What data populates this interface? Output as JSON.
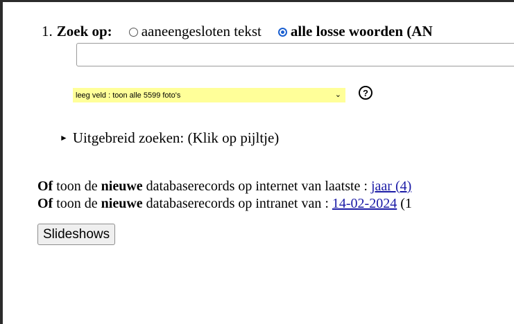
{
  "search": {
    "step_number": "1.",
    "label": "Zoek op:",
    "options": [
      {
        "label": "aaneengesloten tekst",
        "checked": false
      },
      {
        "label": "alle losse woorden (AN",
        "checked": true
      }
    ],
    "input_value": ""
  },
  "filter": {
    "selected": "leeg veld : toon alle 5599 foto's",
    "background_color": "#ffff99",
    "help_icon": "question-circle-icon",
    "help_text": "?"
  },
  "advanced": {
    "arrow_icon": "triangle-right-icon",
    "arrow_glyph": "►",
    "label": "Uitgebreid zoeken: (Klik op pijltje)"
  },
  "records": {
    "line1": {
      "of": "Of",
      "t1": " toon de ",
      "bold": "nieuwe",
      "t2": " databaserecords op internet van laatste : ",
      "link": "jaar (4)"
    },
    "line2": {
      "of": "Of",
      "t1": " toon de ",
      "bold": "nieuwe",
      "t2": " databaserecords op intranet van : ",
      "link": "14-02-2024",
      "tail": " (1"
    }
  },
  "slideshows_label": "Slideshows"
}
